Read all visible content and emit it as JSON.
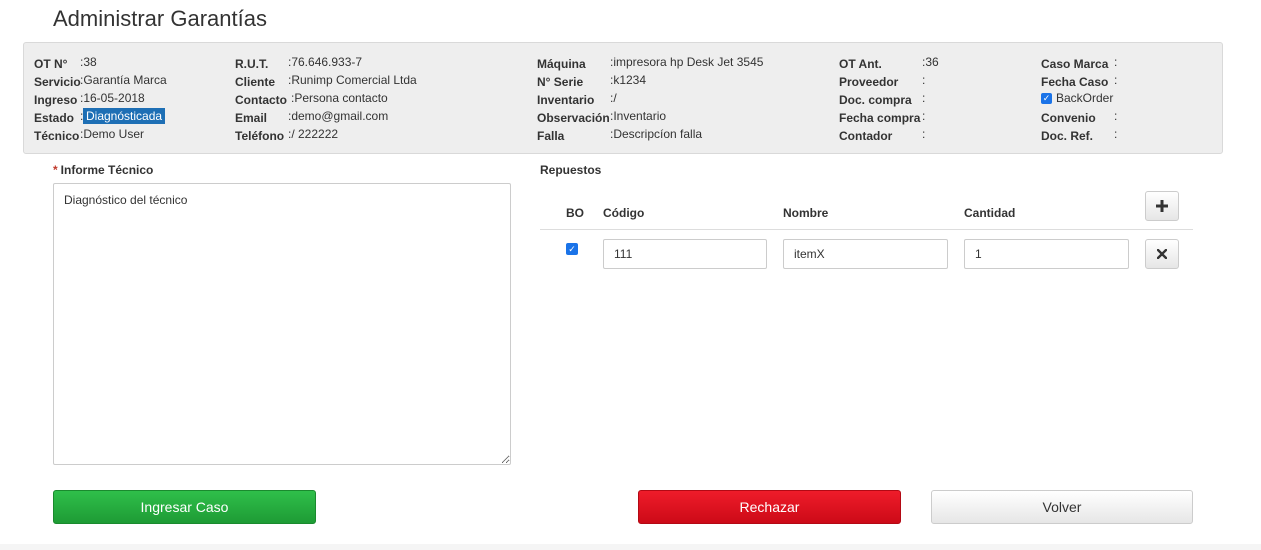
{
  "page": {
    "title": "Administrar Garantías"
  },
  "info": {
    "col1": [
      {
        "label": "OT N°",
        "value": ":38"
      },
      {
        "label": "Servicio",
        "value": ":Garantía Marca"
      },
      {
        "label": "Ingreso",
        "value": ":16-05-2018"
      },
      {
        "label": "Estado",
        "value": "Diagnósticada",
        "prefix": ":"
      },
      {
        "label": "Técnico",
        "value": ":Demo User"
      }
    ],
    "col2": [
      {
        "label": "R.U.T.",
        "value": ":76.646.933-7"
      },
      {
        "label": "Cliente",
        "value": ":Runimp Comercial Ltda"
      },
      {
        "label": "Contacto",
        "value": ":Persona contacto"
      },
      {
        "label": "Email",
        "value": ":demo@gmail.com"
      },
      {
        "label": "Teléfono",
        "value": ":/ 222222"
      }
    ],
    "col3": [
      {
        "label": "Máquina",
        "value": ":impresora hp Desk Jet 3545"
      },
      {
        "label": "N° Serie",
        "value": ":k1234"
      },
      {
        "label": "Inventario",
        "value": ":/"
      },
      {
        "label": "Observación",
        "value": ":Inventario"
      },
      {
        "label": "Falla",
        "value": ":Descripcíon falla"
      }
    ],
    "col4": [
      {
        "label": "OT Ant.",
        "value": ":36"
      },
      {
        "label": "Proveedor",
        "value": ":"
      },
      {
        "label": "Doc. compra",
        "value": ":"
      },
      {
        "label": "Fecha compra",
        "value": ":"
      },
      {
        "label": "Contador",
        "value": ":"
      }
    ],
    "col5": [
      {
        "label": "Caso Marca",
        "value": ":"
      },
      {
        "label": "Fecha Caso",
        "value": ":"
      },
      {
        "label": "",
        "value": "BackOrder",
        "checkbox": true
      },
      {
        "label": "Convenio",
        "value": ":"
      },
      {
        "label": "Doc. Ref.",
        "value": ":"
      }
    ]
  },
  "informe": {
    "required_mark": "*",
    "label": "Informe Técnico",
    "value": "Diagnóstico del técnico"
  },
  "repuestos": {
    "label": "Repuestos",
    "columns": [
      "BO",
      "Código",
      "Nombre",
      "Cantidad"
    ],
    "add_icon": "plus-icon",
    "rows": [
      {
        "bo": true,
        "codigo": "111",
        "nombre": "itemX",
        "cantidad": "1",
        "remove_icon": "close-icon"
      }
    ]
  },
  "buttons": {
    "ingresar": "Ingresar Caso",
    "rechazar": "Rechazar",
    "volver": "Volver"
  },
  "colors": {
    "green": "#22a83c",
    "red": "#e0111f",
    "highlight": "#1e6fb5",
    "checkbox": "#1a73e8"
  }
}
